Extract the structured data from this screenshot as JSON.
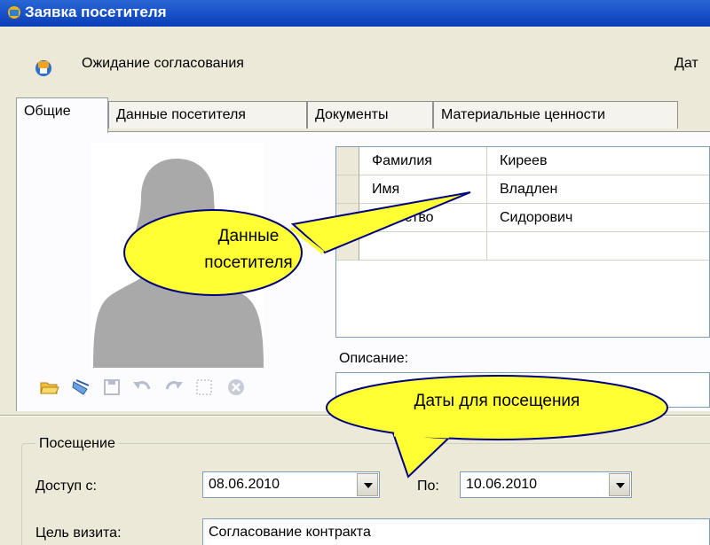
{
  "window": {
    "title": "Заявка посетителя"
  },
  "status": {
    "text": "Ожидание согласования",
    "date_label": "Дат"
  },
  "tabs": [
    {
      "label": "Общие"
    },
    {
      "label": "Данные посетителя"
    },
    {
      "label": "Документы"
    },
    {
      "label": "Материальные ценности"
    }
  ],
  "visitor_grid": {
    "rows": [
      {
        "field": "Фамилия",
        "value": "Киреев"
      },
      {
        "field": "Имя",
        "value": "Владлен"
      },
      {
        "field": "Отчество",
        "value": "Сидорович"
      },
      {
        "field": "",
        "value": ""
      }
    ]
  },
  "description": {
    "label": "Описание:",
    "value": ""
  },
  "photo_toolbar": [
    "open-folder-icon",
    "scan-icon",
    "save-icon",
    "undo-icon",
    "redo-icon",
    "crop-icon",
    "delete-icon"
  ],
  "visit": {
    "group_label": "Посещение",
    "access_from_label": "Доступ с:",
    "access_from_value": "08.06.2010",
    "to_label": "По:",
    "to_value": "10.06.2010",
    "purpose_label": "Цель визита:",
    "purpose_value": "Согласование контракта"
  },
  "callouts": {
    "visitor_data": [
      "Данные",
      "посетителя"
    ],
    "visit_dates": "Даты для посещения"
  },
  "colors": {
    "title_bar": "#0a3eb5",
    "window_bg": "#ece9d8",
    "callout_fill": "#ffff33",
    "callout_border": "#000080"
  }
}
